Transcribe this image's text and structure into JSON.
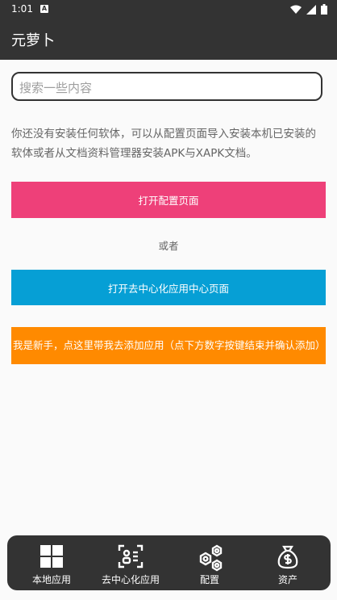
{
  "status_bar": {
    "time": "1:01",
    "notification": "A"
  },
  "app": {
    "title": "元萝卜"
  },
  "search": {
    "placeholder": "搜索一些内容"
  },
  "main": {
    "info": "你还没有安装任何软体，可以从配置页面导入安装本机已安装的软体或者从文档资料管理器安装APK与XAPK文档。",
    "open_config_label": "打开配置页面",
    "or_label": "或者",
    "open_decentral_label": "打开去中心化应用中心页面",
    "newbie_label": "我是新手，点这里带我去添加应用（点下方数字按键结束并确认添加）"
  },
  "bottom_nav": {
    "items": [
      {
        "label": "本地应用",
        "icon": "grid-icon"
      },
      {
        "label": "去中心化应用",
        "icon": "scan-users-icon"
      },
      {
        "label": "配置",
        "icon": "hexagons-icon"
      },
      {
        "label": "资产",
        "icon": "money-bag-icon"
      }
    ]
  },
  "colors": {
    "bar": "#333333",
    "config_button": "#ee4079",
    "decentral_button": "#069fd5",
    "newbie_button": "#ff8a00"
  }
}
